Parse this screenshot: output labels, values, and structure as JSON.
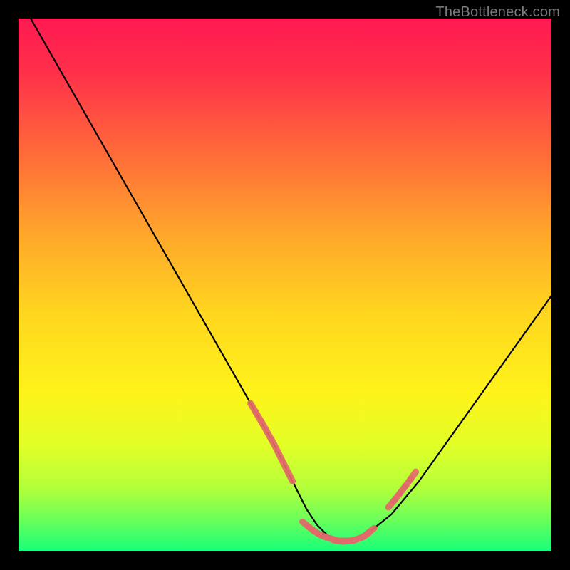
{
  "watermark": "TheBottleneck.com",
  "chart_data": {
    "type": "line",
    "title": "",
    "xlabel": "",
    "ylabel": "",
    "xlim": [
      0,
      100
    ],
    "ylim": [
      0,
      100
    ],
    "grid": false,
    "legend": false,
    "series": [
      {
        "name": "bottleneck-curve",
        "x": [
          0,
          4,
          8,
          12,
          16,
          20,
          24,
          28,
          32,
          36,
          40,
          44,
          48,
          50,
          52,
          54,
          56,
          58,
          60,
          62,
          65,
          70,
          75,
          80,
          85,
          90,
          95,
          100
        ],
        "y": [
          104,
          97,
          90,
          83,
          76,
          69,
          62,
          55,
          48,
          41,
          34,
          27,
          20,
          16,
          12,
          8,
          5,
          3,
          2,
          2,
          3,
          7,
          13,
          20,
          27,
          34,
          41,
          48
        ],
        "color": "#000000"
      },
      {
        "name": "highlight-markers-left",
        "x": [
          44,
          45,
          46,
          47,
          48,
          49,
          50,
          51
        ],
        "y": [
          27,
          25.3,
          23.6,
          21.8,
          20,
          18,
          16,
          14
        ],
        "color": "#e26a6a"
      },
      {
        "name": "highlight-markers-bottom",
        "x": [
          54,
          55,
          56,
          57,
          58,
          59,
          60,
          61,
          62,
          63,
          64,
          65,
          66
        ],
        "y": [
          5,
          4.2,
          3.5,
          3,
          2.6,
          2.3,
          2,
          2,
          2,
          2.2,
          2.5,
          3,
          3.8
        ],
        "color": "#e26a6a"
      },
      {
        "name": "highlight-markers-right",
        "x": [
          70,
          71,
          72,
          73,
          74
        ],
        "y": [
          9,
          10.2,
          11.5,
          12.8,
          14.2
        ],
        "color": "#e26a6a"
      }
    ],
    "gradient_stops": [
      {
        "offset": 0.0,
        "color": "#ff1a52"
      },
      {
        "offset": 0.1,
        "color": "#ff2f4a"
      },
      {
        "offset": 0.25,
        "color": "#ff6a3a"
      },
      {
        "offset": 0.4,
        "color": "#ffa52c"
      },
      {
        "offset": 0.55,
        "color": "#ffd51f"
      },
      {
        "offset": 0.7,
        "color": "#fff31a"
      },
      {
        "offset": 0.8,
        "color": "#e2ff27"
      },
      {
        "offset": 0.88,
        "color": "#b4ff3a"
      },
      {
        "offset": 0.94,
        "color": "#6bff5a"
      },
      {
        "offset": 1.0,
        "color": "#16ff7a"
      }
    ]
  }
}
